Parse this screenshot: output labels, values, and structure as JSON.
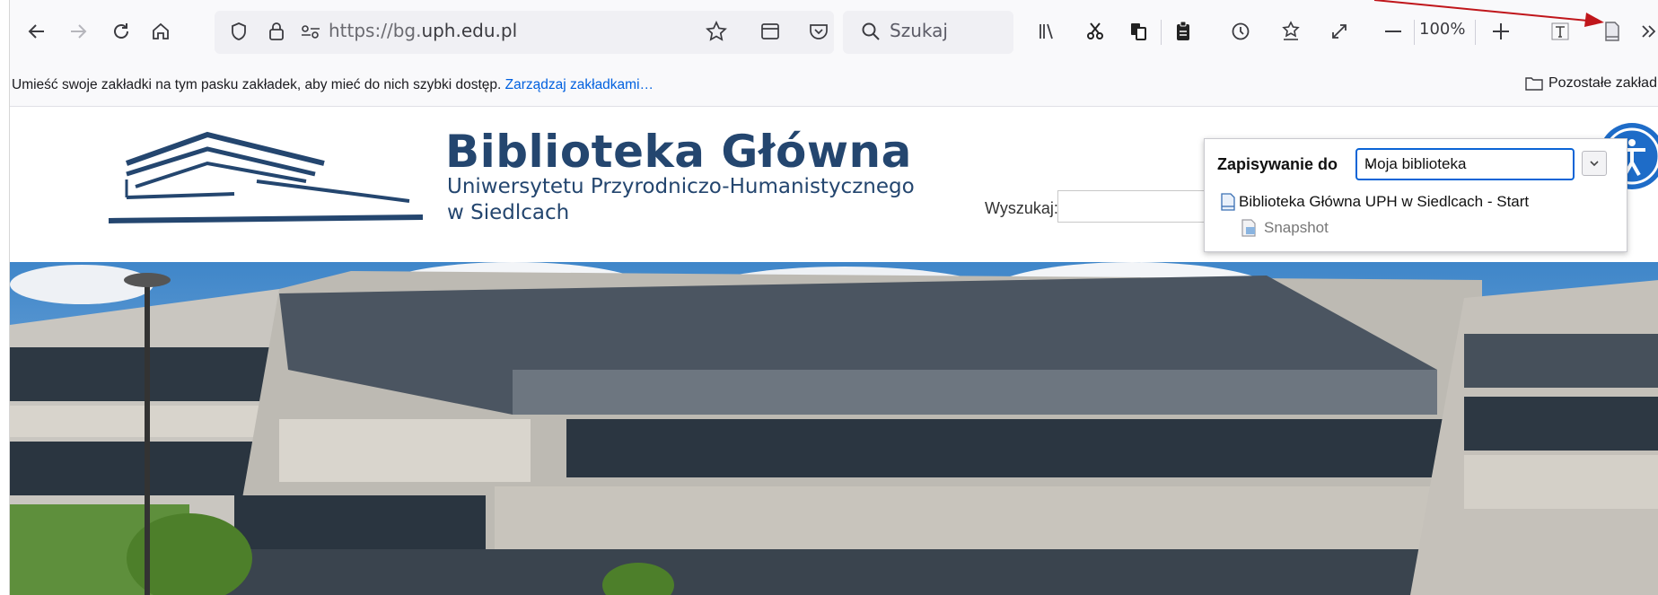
{
  "browser": {
    "url_prefix": "https://bg.",
    "url_domain": "uph.edu.pl",
    "url_suffix": "",
    "search_placeholder": "Szukaj",
    "zoom": "100%"
  },
  "bookmarks_bar": {
    "hint_text": "Umieść swoje zakładki na tym pasku zakładek, aby mieć do nich szybki dostęp.",
    "manage_link": "Zarządzaj zakładkami…",
    "other_bookmarks": "Pozostałe zakładk"
  },
  "site": {
    "title": "Biblioteka Główna",
    "subtitle_line1": "Uniwersytetu Przyrodniczo-Humanistycznego",
    "subtitle_line2": "w Siedlcach",
    "search_label": "Wyszukaj:"
  },
  "zotero_popup": {
    "save_to_label": "Zapisywanie do",
    "collection": "Moja biblioteka",
    "item_title": "Biblioteka Główna UPH w Siedlcach - Start",
    "attachment": "Snapshot"
  },
  "colors": {
    "brand_blue": "#24466f",
    "accent_arrow": "#c0161b",
    "accessibility_blue": "#1e6cc8",
    "focus_blue": "#0a64d6"
  }
}
